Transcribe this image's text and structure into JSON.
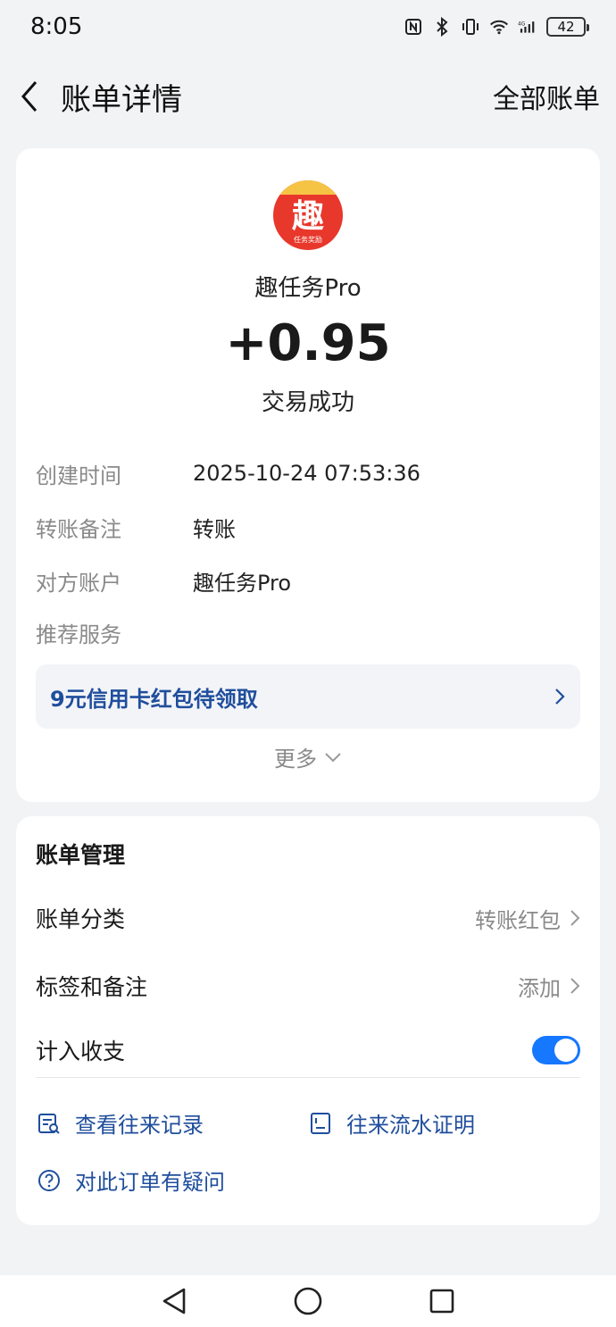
{
  "status_bar": {
    "time": "8:05",
    "battery": "42",
    "icons": [
      "nfc-icon",
      "bluetooth-icon",
      "vibrate-icon",
      "wifi-icon",
      "signal-4g-icon",
      "battery-icon"
    ]
  },
  "nav": {
    "title": "账单详情",
    "right_link": "全部账单"
  },
  "transaction": {
    "logo_char": "趣",
    "logo_sub": "任务奖励",
    "merchant": "趣任务Pro",
    "amount": "+0.95",
    "status": "交易成功"
  },
  "details": [
    {
      "label": "创建时间",
      "value": "2025-10-24 07:53:36"
    },
    {
      "label": "转账备注",
      "value": "转账"
    },
    {
      "label": "对方账户",
      "value": "趣任务Pro"
    },
    {
      "label": "推荐服务",
      "value": ""
    }
  ],
  "promo": {
    "text": "9元信用卡红包待领取"
  },
  "more_label": "更多",
  "manage": {
    "title": "账单管理",
    "category_label": "账单分类",
    "category_value": "转账红包",
    "tags_label": "标签和备注",
    "tags_value": "添加",
    "include_label": "计入收支",
    "include_on": true
  },
  "links": {
    "records": "查看往来记录",
    "proof": "往来流水证明",
    "question": "对此订单有疑问"
  },
  "colors": {
    "accent": "#1677ff",
    "link": "#1f4e9c",
    "logo_red": "#e8372b",
    "logo_gold": "#f6c445"
  }
}
